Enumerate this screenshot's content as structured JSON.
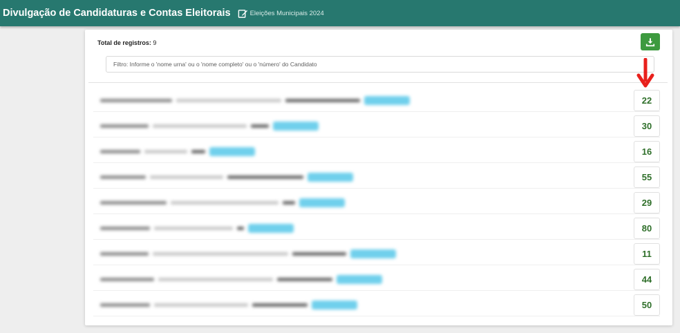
{
  "header": {
    "title": "Divulgação de Candidaturas e Contas Eleitorais",
    "subtitle": "Eleições Municipais 2024"
  },
  "summary": {
    "total_label": "Total de registros:",
    "total_value": "9"
  },
  "filter": {
    "placeholder": "Filtro: Informe o 'nome urna' ou o 'nome completo' ou o 'número' do Candidato",
    "value": ""
  },
  "icons": {
    "edit": "edit-icon",
    "download": "download-icon",
    "annotation": "red-down-arrow-icon"
  },
  "colors": {
    "header_bg": "#27786f",
    "download_btn": "#3d9a3f",
    "number_text": "#2f6f2a",
    "badge": "#70d0ec",
    "annotation_arrow": "#e8201c"
  },
  "candidates": [
    {
      "number": "22"
    },
    {
      "number": "30"
    },
    {
      "number": "16"
    },
    {
      "number": "55"
    },
    {
      "number": "29"
    },
    {
      "number": "80"
    },
    {
      "number": "11"
    },
    {
      "number": "44"
    },
    {
      "number": "50"
    }
  ]
}
